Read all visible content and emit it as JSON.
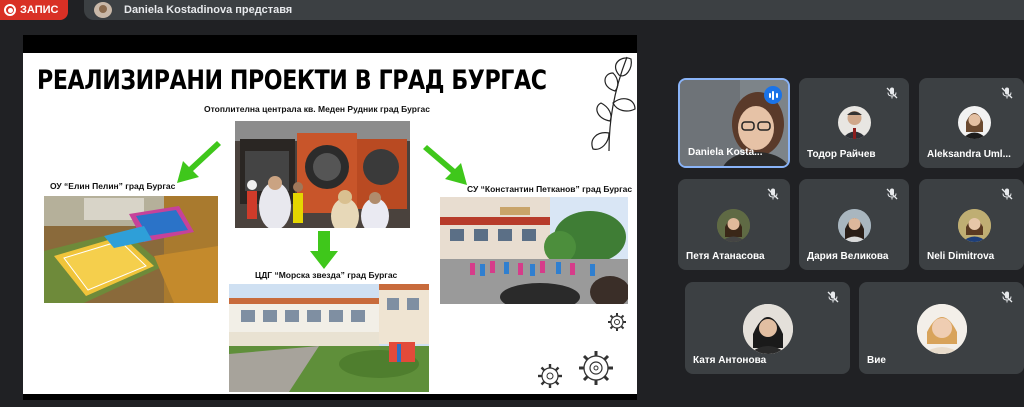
{
  "recording": {
    "label": "ЗАПИС",
    "color": "#d93025"
  },
  "presenter": {
    "text": "Daniela Kostadinova представя"
  },
  "slide": {
    "title": "РЕАЛИЗИРАНИ ПРОЕКТИ В ГРАД БУРГАС",
    "captions": {
      "center_top": "Отоплителна централа кв. Меден Рудник град Бургас",
      "left": "ОУ “Елин Пелин” град Бургас",
      "right": "СУ “Константин Петканов” град Бургас",
      "bottom": "ЦДГ “Морска звезда” град Бургас"
    },
    "arrow_color": "#3fc71b"
  },
  "participants": [
    {
      "name": "Daniela Kosta...",
      "icon": "speaking-indicator-icon",
      "active": true
    },
    {
      "name": "Тодор Райчев",
      "icon": "mic-off-icon"
    },
    {
      "name": "Aleksandra Uml...",
      "icon": "mic-off-icon"
    },
    {
      "name": "Петя Атанасова",
      "icon": "mic-off-icon"
    },
    {
      "name": "Дария Великова",
      "icon": "mic-off-icon"
    },
    {
      "name": "Neli Dimitrova",
      "icon": "mic-off-icon"
    },
    {
      "name": "Катя Антонова",
      "icon": "mic-off-icon"
    },
    {
      "name": "Вие",
      "icon": "mic-off-icon"
    }
  ],
  "colors": {
    "background": "#202124",
    "tile": "#3c4043",
    "active_border": "#8ab4f8",
    "speaking": "#1a73e8"
  }
}
